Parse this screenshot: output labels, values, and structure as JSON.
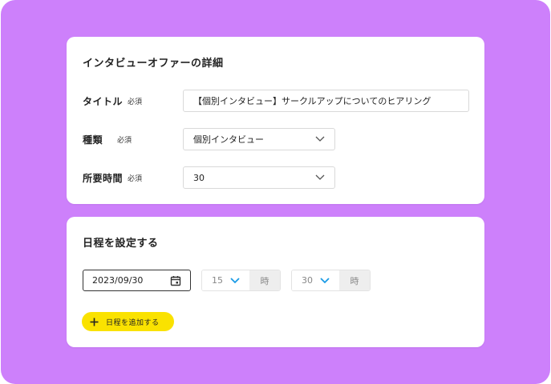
{
  "detail": {
    "title": "インタビューオファーの詳細",
    "fields": {
      "title": {
        "label": "タイトル",
        "required": "必須",
        "value": "【個別インタビュー】サークルアップについてのヒアリング"
      },
      "type": {
        "label": "種類",
        "required": "必須",
        "value": "個別インタビュー"
      },
      "duration": {
        "label": "所要時間",
        "required": "必須",
        "value": "30"
      }
    }
  },
  "schedule": {
    "title": "日程を設定する",
    "date": "2023/09/30",
    "hour": {
      "value": "15",
      "unit": "時"
    },
    "minute": {
      "value": "30",
      "unit": "時"
    },
    "add_label": "日程を追加する"
  },
  "colors": {
    "background": "#cd80fb",
    "card": "#ffffff",
    "accent_button": "#fae200",
    "chevron_blue": "#1a9be6"
  },
  "icons": {
    "chevron": "chevron-down-icon",
    "calendar": "calendar-icon",
    "plus": "plus-icon"
  }
}
